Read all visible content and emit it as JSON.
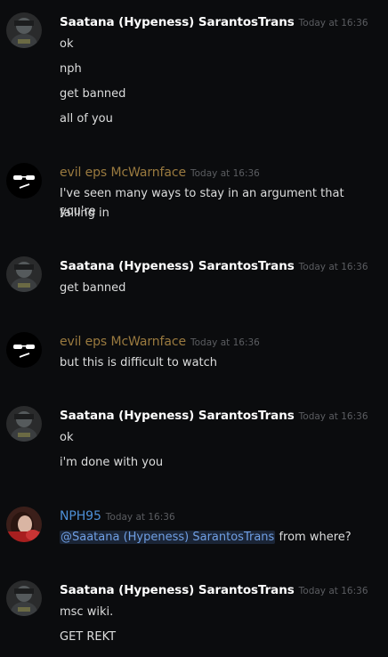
{
  "messages": [
    {
      "author": "Saatana (Hypeness) SarantosTrans",
      "timestamp": "Today at 16:36",
      "lines": [
        "ok",
        "nph",
        "get banned",
        "all of you"
      ]
    },
    {
      "author": "evil eps McWarnface",
      "timestamp": "Today at 16:36",
      "lines": [
        "I've seen many ways to stay in an argument that you're",
        "failing in"
      ]
    },
    {
      "author": "Saatana (Hypeness) SarantosTrans",
      "timestamp": "Today at 16:36",
      "lines": [
        "get banned"
      ]
    },
    {
      "author": "evil eps McWarnface",
      "timestamp": "Today at 16:36",
      "lines": [
        "but this is difficult to watch"
      ]
    },
    {
      "author": "Saatana (Hypeness) SarantosTrans",
      "timestamp": "Today at 16:36",
      "lines": [
        "ok",
        "i'm done with you"
      ]
    },
    {
      "author": "NPH95",
      "timestamp": "Today at 16:36",
      "mention": "@Saatana (Hypeness) SarantosTrans",
      "lines": [
        " from where?"
      ]
    },
    {
      "author": "Saatana (Hypeness) SarantosTrans",
      "timestamp": "Today at 16:36",
      "lines": [
        "msc wiki.",
        "GET REKT"
      ]
    }
  ],
  "colors": {
    "background": "#0b0c0e",
    "username_default": "#ffffff",
    "username_eps": "#9a7a3f",
    "username_nph": "#4d8fd6",
    "mention": "#6f9fe4"
  }
}
